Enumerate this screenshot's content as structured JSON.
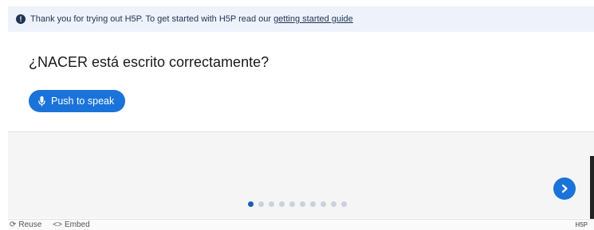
{
  "notice": {
    "text": "Thank you for trying out H5P. To get started with H5P read our",
    "link_label": "getting started guide",
    "icon": "info-circle-icon"
  },
  "question": {
    "text": "¿NACER está escrito correctamente?"
  },
  "speak_button": {
    "label": "Push to speak",
    "icon": "microphone-icon"
  },
  "navigation": {
    "next_icon": "chevron-right-icon",
    "total_slides": 10,
    "current_slide": 1
  },
  "footer": {
    "reuse_label": "Reuse",
    "embed_label": "Embed",
    "logo_text": "H5P"
  },
  "colors": {
    "accent": "#1a73d9",
    "notice_bg": "#eef2fa",
    "nav_bg": "#f5f5f5",
    "dot_active": "#1a5fb4",
    "dot_inactive": "#c9d1de"
  }
}
